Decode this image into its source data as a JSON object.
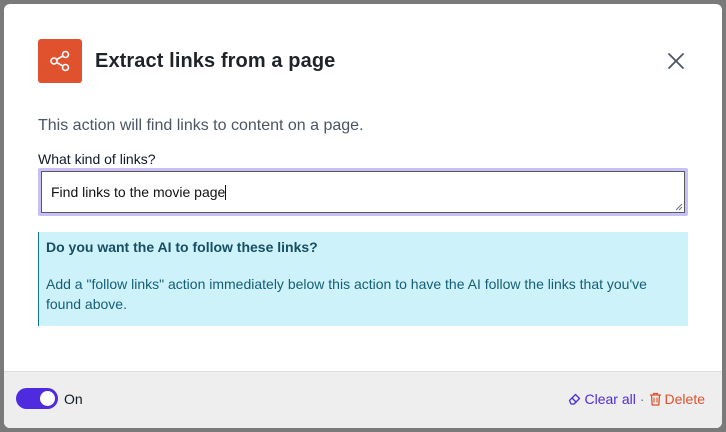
{
  "dialog": {
    "title": "Extract links from a page",
    "icon": "share-nodes-icon",
    "close_icon": "close-icon",
    "description": "This action will find links to content on a page.",
    "field_label": "What kind of links?",
    "field_value": "Find links to the movie page",
    "info": {
      "title": "Do you want the AI to follow these links?",
      "body": "Add a \"follow links\" action immediately below this action to have the AI follow the links that you've found above."
    }
  },
  "footer": {
    "toggle_state": "on",
    "toggle_label": "On",
    "clear_label": "Clear all",
    "separator": "·",
    "delete_label": "Delete"
  },
  "colors": {
    "accent": "#4f2be0",
    "brand": "#e0522e",
    "info_bg": "#cdf2fa",
    "info_text": "#155e75"
  }
}
